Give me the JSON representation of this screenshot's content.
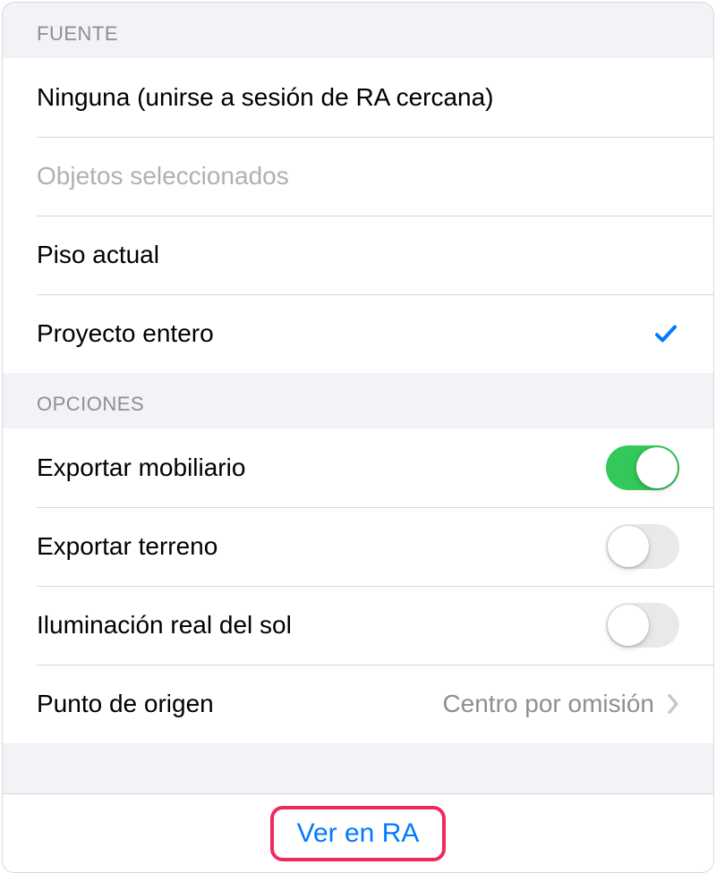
{
  "sections": {
    "source": {
      "header": "FUENTE",
      "items": [
        {
          "label": "Ninguna (unirse a sesión de RA cercana)",
          "selected": false,
          "disabled": false
        },
        {
          "label": "Objetos seleccionados",
          "selected": false,
          "disabled": true
        },
        {
          "label": "Piso actual",
          "selected": false,
          "disabled": false
        },
        {
          "label": "Proyecto entero",
          "selected": true,
          "disabled": false
        }
      ]
    },
    "options": {
      "header": "OPCIONES",
      "export_furniture": {
        "label": "Exportar mobiliario",
        "value": true
      },
      "export_terrain": {
        "label": "Exportar terreno",
        "value": false
      },
      "real_sun_lighting": {
        "label": "Iluminación real del sol",
        "value": false
      },
      "origin_point": {
        "label": "Punto de origen",
        "value": "Centro por omisión"
      }
    }
  },
  "footer": {
    "view_in_ar": "Ver en RA"
  }
}
